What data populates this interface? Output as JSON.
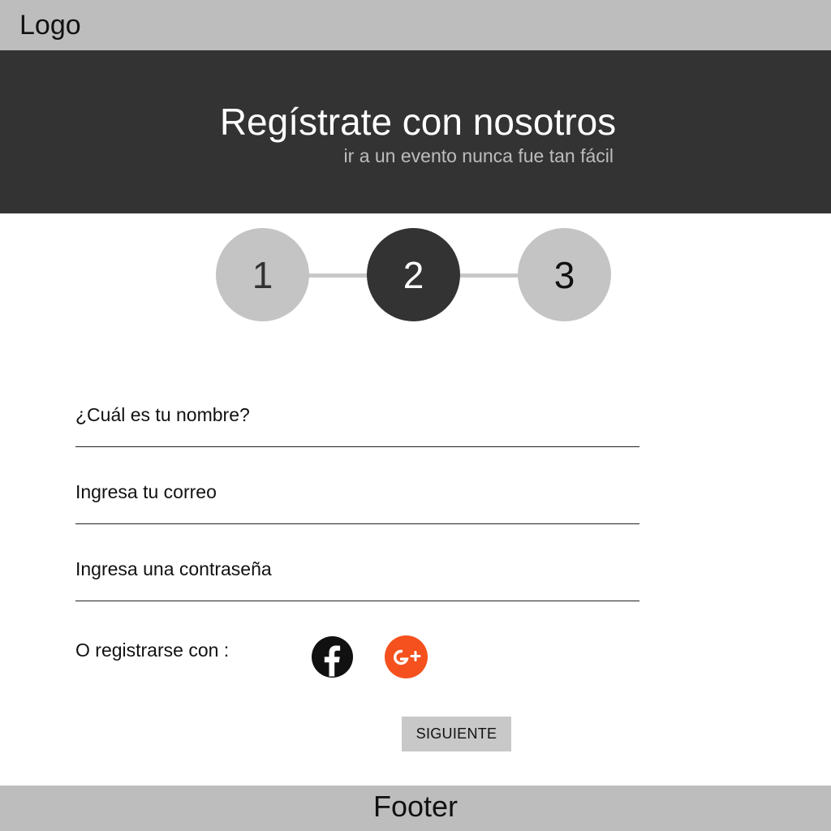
{
  "header": {
    "logo": "Logo"
  },
  "hero": {
    "title": "Regístrate con nosotros",
    "subtitle": "ir a un evento nunca fue tan fácil"
  },
  "stepper": {
    "steps": [
      "1",
      "2",
      "3"
    ],
    "active_step": 2
  },
  "form": {
    "name_placeholder": "¿Cuál es tu nombre?",
    "email_placeholder": "Ingresa tu correo",
    "password_placeholder": "Ingresa una contraseña",
    "name_value": "",
    "email_value": "",
    "password_value": ""
  },
  "social": {
    "label": "O registrarse con :",
    "facebook_icon": "facebook-icon",
    "google_plus_icon": "google-plus-icon",
    "colors": {
      "facebook": "#111111",
      "google_plus": "#f4511e"
    }
  },
  "actions": {
    "next_label": "SIGUIENTE"
  },
  "footer": {
    "label": "Footer"
  },
  "colors": {
    "dark": "#333333",
    "gray": "#bdbdbd",
    "accent": "#f4511e"
  }
}
